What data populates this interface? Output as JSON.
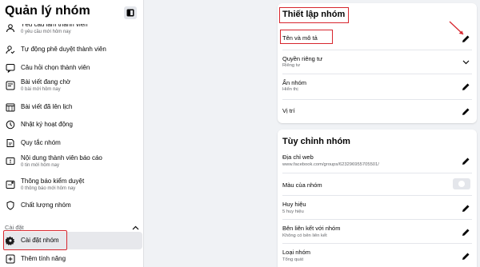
{
  "sidebar": {
    "title": "Quản lý nhóm",
    "items": [
      {
        "label": "Yêu cầu làm thành viên",
        "sub": "0 yêu cầu mới hôm nay",
        "icon": "member-request-icon"
      },
      {
        "label": "Tự động phê duyệt thành viên",
        "sub": "",
        "icon": "auto-approve-icon"
      },
      {
        "label": "Câu hỏi chọn thành viên",
        "sub": "",
        "icon": "question-icon"
      },
      {
        "label": "Bài viết đang chờ",
        "sub": "0 bài mới hôm nay",
        "icon": "pending-posts-icon"
      },
      {
        "label": "Bài viết đã lên lịch",
        "sub": "",
        "icon": "calendar-icon"
      },
      {
        "label": "Nhật ký hoạt động",
        "sub": "",
        "icon": "activity-log-icon"
      },
      {
        "label": "Quy tắc nhóm",
        "sub": "",
        "icon": "rules-icon"
      },
      {
        "label": "Nội dung thành viên báo cáo",
        "sub": "0 tin mới hôm nay",
        "icon": "report-icon"
      },
      {
        "label": "Thông báo kiểm duyệt",
        "sub": "0 thông báo mới hôm nay",
        "icon": "moderation-alert-icon"
      },
      {
        "label": "Chất lượng nhóm",
        "sub": "",
        "icon": "quality-icon"
      }
    ],
    "section_label": "Cài đặt",
    "settings_items": [
      {
        "label": "Cài đặt nhóm",
        "icon": "gear-icon"
      },
      {
        "label": "Thêm tính năng",
        "icon": "add-features-icon"
      }
    ]
  },
  "settings_card": {
    "title": "Thiết lập nhóm",
    "rows": [
      {
        "label": "Tên và mô tả",
        "sub": "",
        "action": "pencil-icon"
      },
      {
        "label": "Quyền riêng tư",
        "sub": "Riêng tư",
        "action": "chevron-down-icon"
      },
      {
        "label": "Ẩn nhóm",
        "sub": "Hiển thị",
        "action": "pencil-icon"
      },
      {
        "label": "Vị trí",
        "sub": "",
        "action": "pencil-icon"
      }
    ]
  },
  "customize_card": {
    "title": "Tùy chỉnh nhóm",
    "rows": [
      {
        "label": "Địa chỉ web",
        "sub": "www.facebook.com/groups/623296955705501/",
        "action": "pencil-icon"
      },
      {
        "label": "Màu của nhóm",
        "sub": "",
        "action": "color-swatch"
      },
      {
        "label": "Huy hiệu",
        "sub": "5 huy hiệu",
        "action": "pencil-icon"
      },
      {
        "label": "Bên liên kết với nhóm",
        "sub": "Không có bên liên kết",
        "action": "pencil-icon"
      },
      {
        "label": "Loại nhóm",
        "sub": "Tổng quát",
        "action": "pencil-icon"
      }
    ]
  },
  "colors": {
    "highlight": "#d7262e",
    "page_bg": "#f0f2f5",
    "active_item": "#e7e8ec"
  }
}
